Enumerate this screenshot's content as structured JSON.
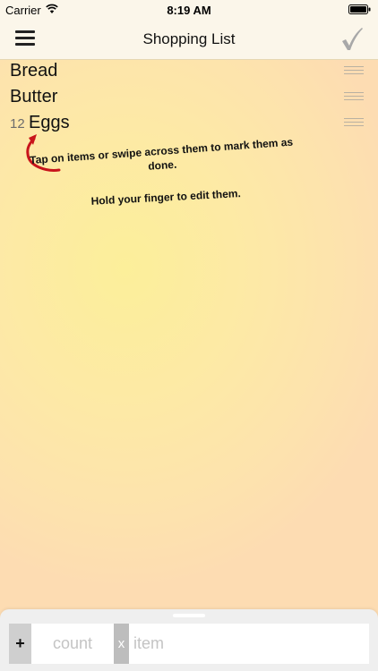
{
  "status_bar": {
    "carrier": "Carrier",
    "time": "8:19 AM",
    "icons": [
      "wifi-icon",
      "battery-icon"
    ]
  },
  "nav_bar": {
    "title": "Shopping List",
    "left_icon": "menu-icon",
    "right_icon": "checkmark-icon"
  },
  "items": [
    {
      "count": "",
      "name": "Bread"
    },
    {
      "count": "",
      "name": "Butter"
    },
    {
      "count": "12",
      "name": "Eggs"
    }
  ],
  "help": {
    "line1": "Tap on items or swipe across them to mark them as done.",
    "line2": "Hold your finger to edit them.",
    "arrow_icon": "curved-arrow-icon",
    "arrow_color": "#c8141b"
  },
  "input_bar": {
    "add_label": "+",
    "count_placeholder": "count",
    "times_label": "x",
    "item_placeholder": "item"
  },
  "colors": {
    "accent_checkmark": "#a8a8a8",
    "background": "#fde9a6"
  }
}
